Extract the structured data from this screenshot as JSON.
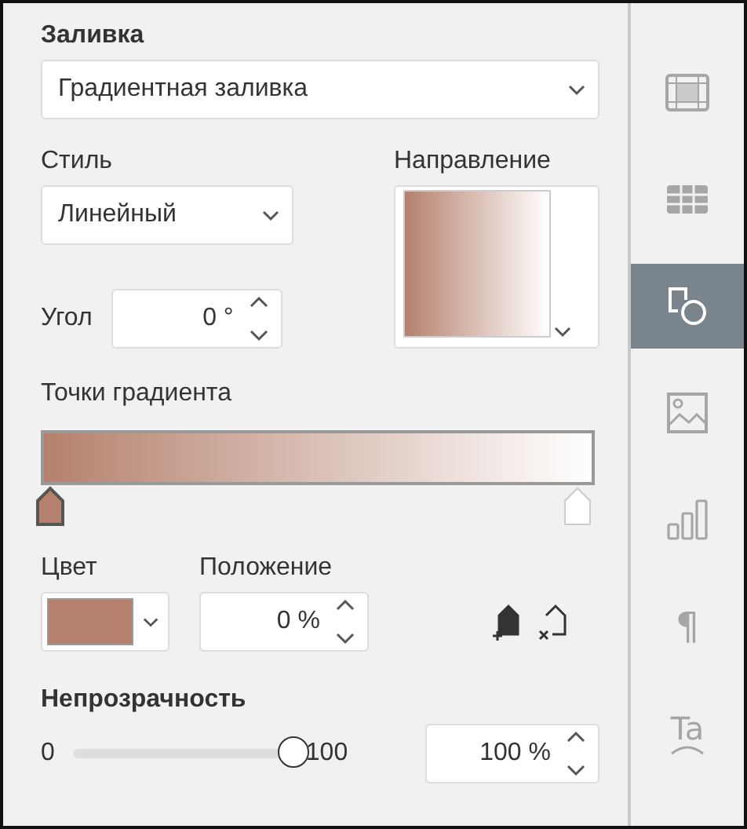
{
  "fill": {
    "title": "Заливка",
    "value": "Градиентная заливка"
  },
  "style": {
    "label": "Стиль",
    "value": "Линейный"
  },
  "direction": {
    "label": "Направление"
  },
  "angle": {
    "label": "Угол",
    "value": "0 °"
  },
  "gradient": {
    "label": "Точки градиента",
    "stops": [
      {
        "color": "#b5816d",
        "selected": true
      },
      {
        "color": "#ffffff",
        "selected": false
      }
    ]
  },
  "stop_color": {
    "label": "Цвет",
    "color": "#b5816d"
  },
  "position": {
    "label": "Положение",
    "value": "0 %"
  },
  "opacity": {
    "title": "Непрозрачность",
    "min": "0",
    "max": "100",
    "level": 1,
    "value": "100 %"
  },
  "sidebar": [
    {
      "kind": "slide",
      "selected": false
    },
    {
      "kind": "table",
      "selected": false
    },
    {
      "kind": "shape",
      "selected": true
    },
    {
      "kind": "image",
      "selected": false
    },
    {
      "kind": "chart",
      "selected": false
    },
    {
      "kind": "paragraph",
      "glyph": "¶",
      "selected": false
    },
    {
      "kind": "textart",
      "glyph": "Ta",
      "selected": false
    }
  ]
}
